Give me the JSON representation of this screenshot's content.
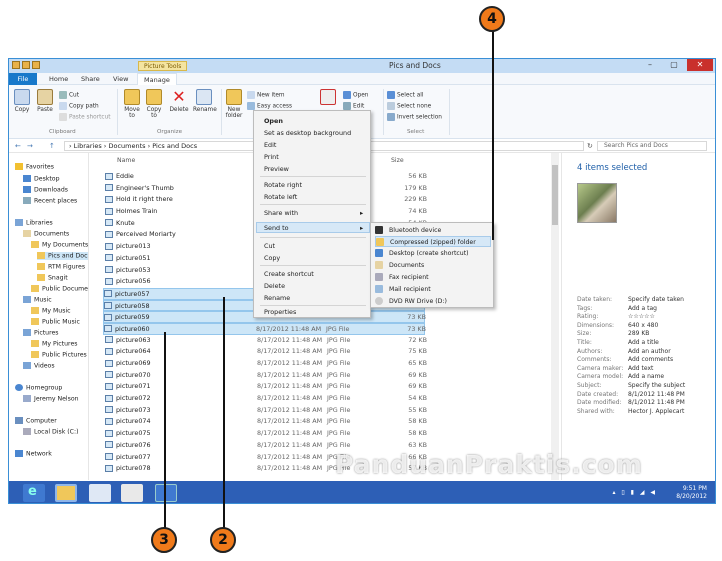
{
  "window": {
    "title": "Pics and Docs",
    "context_tab_label": "Picture Tools",
    "controls": {
      "minimize": "–",
      "maximize": "▢",
      "close": "✕"
    }
  },
  "ribbon": {
    "tabs": [
      "File",
      "Home",
      "Share",
      "View",
      "Manage"
    ],
    "clipboard": {
      "copy": "Copy",
      "paste": "Paste",
      "cut": "Cut",
      "copy_path": "Copy path",
      "paste_shortcut": "Paste shortcut",
      "group": "Clipboard"
    },
    "organize": {
      "move_to": "Move to",
      "copy_to": "Copy to",
      "delete": "Delete",
      "rename": "Rename",
      "group": "Organize"
    },
    "new": {
      "new_folder": "New folder",
      "new_item": "New item",
      "easy_access": "Easy access"
    },
    "open": {
      "open": "Open",
      "edit": "Edit"
    },
    "select": {
      "select_all": "Select all",
      "select_none": "Select none",
      "invert_selection": "Invert selection",
      "group": "Select"
    }
  },
  "address": {
    "path": "›  Libraries  ›  Documents  ›  Pics and Docs",
    "search_placeholder": "Search Pics and Docs",
    "back": "←",
    "forward": "→",
    "up": "↑",
    "refresh": "↻"
  },
  "navpane": {
    "favorites": "Favorites",
    "desktop": "Desktop",
    "downloads": "Downloads",
    "recent_places": "Recent places",
    "libraries": "Libraries",
    "documents": "Documents",
    "my_documents": "My Documents",
    "pics_and_docs": "Pics and Doc",
    "rtm_figures": "RTM Figures",
    "snagit": "Snagit",
    "public_documents": "Public Docume",
    "music": "Music",
    "my_music": "My Music",
    "public_music": "Public Music",
    "pictures": "Pictures",
    "my_pictures": "My Pictures",
    "public_pictures": "Public Pictures",
    "videos": "Videos",
    "homegroup": "Homegroup",
    "jeremy_nelson": "Jeremy Nelson",
    "computer": "Computer",
    "local_disk": "Local Disk (C:)",
    "network": "Network"
  },
  "filelist": {
    "col_name": "Name",
    "col_size": "Size",
    "rows": [
      {
        "name": "Eddie",
        "date": "",
        "type": "",
        "size": "56 KB"
      },
      {
        "name": "Engineer's Thumb",
        "date": "",
        "type": "",
        "size": "179 KB"
      },
      {
        "name": "Hold it right there",
        "date": "",
        "type": "",
        "size": "229 KB"
      },
      {
        "name": "Holmes Train",
        "date": "",
        "type": "",
        "size": "74 KB"
      },
      {
        "name": "Knute",
        "date": "",
        "type": "",
        "size": "54 KB"
      },
      {
        "name": "Perceived Moriarty",
        "date": "",
        "type": "",
        "size": "84 KB"
      },
      {
        "name": "picture013",
        "date": "",
        "type": "",
        "size": "89 KB"
      },
      {
        "name": "picture051",
        "date": "",
        "type": "",
        "size": "66 KB"
      },
      {
        "name": "picture053",
        "date": "",
        "type": "",
        "size": "95 KB"
      },
      {
        "name": "picture056",
        "date": "",
        "type": "",
        "size": "76 KB"
      },
      {
        "name": "picture057",
        "date": "",
        "type": "",
        "size": "73 KB",
        "selected": true
      },
      {
        "name": "picture058",
        "date": "",
        "type": "",
        "size": "73 KB",
        "selected": true
      },
      {
        "name": "picture059",
        "date": "",
        "type": "",
        "size": "73 KB",
        "selected": true
      },
      {
        "name": "picture060",
        "date": "8/17/2012 11:48 AM",
        "type": "JPG File",
        "size": "73 KB",
        "selected": true
      },
      {
        "name": "picture063",
        "date": "8/17/2012 11:48 AM",
        "type": "JPG File",
        "size": "72 KB"
      },
      {
        "name": "picture064",
        "date": "8/17/2012 11:48 AM",
        "type": "JPG File",
        "size": "75 KB"
      },
      {
        "name": "picture069",
        "date": "8/17/2012 11:48 AM",
        "type": "JPG File",
        "size": "65 KB"
      },
      {
        "name": "picture070",
        "date": "8/17/2012 11:48 AM",
        "type": "JPG File",
        "size": "69 KB"
      },
      {
        "name": "picture071",
        "date": "8/17/2012 11:48 AM",
        "type": "JPG File",
        "size": "69 KB"
      },
      {
        "name": "picture072",
        "date": "8/17/2012 11:48 AM",
        "type": "JPG File",
        "size": "54 KB"
      },
      {
        "name": "picture073",
        "date": "8/17/2012 11:48 AM",
        "type": "JPG File",
        "size": "55 KB"
      },
      {
        "name": "picture074",
        "date": "8/17/2012 11:48 AM",
        "type": "JPG File",
        "size": "58 KB"
      },
      {
        "name": "picture075",
        "date": "8/17/2012 11:48 AM",
        "type": "JPG File",
        "size": "58 KB"
      },
      {
        "name": "picture076",
        "date": "8/17/2012 11:48 AM",
        "type": "JPG File",
        "size": "63 KB"
      },
      {
        "name": "picture077",
        "date": "8/17/2012 11:48 AM",
        "type": "JPG File",
        "size": "66 KB"
      },
      {
        "name": "picture078",
        "date": "8/17/2012 11:48 AM",
        "type": "JPG File",
        "size": "57 KB"
      }
    ]
  },
  "context_menu": {
    "open": "Open",
    "set_desktop_bg": "Set as desktop background",
    "edit": "Edit",
    "print": "Print",
    "preview": "Preview",
    "rotate_right": "Rotate right",
    "rotate_left": "Rotate left",
    "share_with": "Share with",
    "send_to": "Send to",
    "cut": "Cut",
    "copy": "Copy",
    "create_shortcut": "Create shortcut",
    "delete": "Delete",
    "rename": "Rename",
    "properties": "Properties",
    "submenu_arrow": "▸"
  },
  "send_to_menu": {
    "bluetooth": "Bluetooth device",
    "compressed": "Compressed (zipped) folder",
    "desktop_shortcut": "Desktop (create shortcut)",
    "documents": "Documents",
    "fax": "Fax recipient",
    "mail": "Mail recipient",
    "dvd": "DVD RW Drive (D:)"
  },
  "details": {
    "title": "4 items selected",
    "rows": [
      {
        "k": "Date taken:",
        "v": "Specify date taken"
      },
      {
        "k": "Tags:",
        "v": "Add a tag"
      },
      {
        "k": "Rating:",
        "v": "☆☆☆☆☆"
      },
      {
        "k": "Dimensions:",
        "v": "640 x 480"
      },
      {
        "k": "Size:",
        "v": "289 KB"
      },
      {
        "k": "Title:",
        "v": "Add a title"
      },
      {
        "k": "Authors:",
        "v": "Add an author"
      },
      {
        "k": "Comments:",
        "v": "Add comments"
      },
      {
        "k": "Camera maker:",
        "v": "Add text"
      },
      {
        "k": "Camera model:",
        "v": "Add a name"
      },
      {
        "k": "Subject:",
        "v": "Specify the subject"
      },
      {
        "k": "Date created:",
        "v": "8/1/2012 11:48 PM"
      },
      {
        "k": "Date modified:",
        "v": "8/1/2012 11:48 PM"
      },
      {
        "k": "Shared with:",
        "v": "Hector J. Applecart"
      }
    ]
  },
  "taskbar": {
    "time": "9:51 PM",
    "date": "8/20/2012",
    "tray_icons": "▴ ▯ ▮ ◢ ◀"
  },
  "callouts": {
    "c2": "2",
    "c3": "3",
    "c4": "4"
  },
  "watermark": "PanduanPraktis.com",
  "colors": {
    "accent": "#1979ca",
    "selection": "#cde6f7",
    "callout": "#f07a1a",
    "taskbar": "#2d5fb6"
  }
}
